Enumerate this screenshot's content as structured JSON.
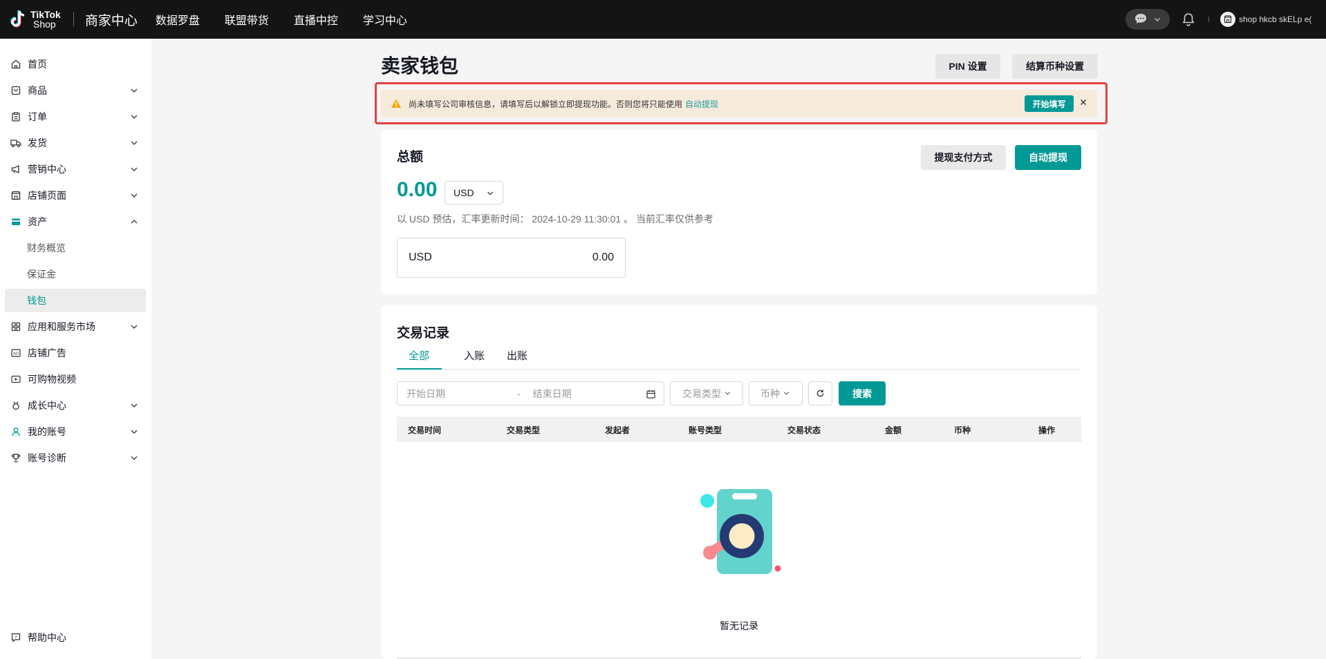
{
  "brand": {
    "logo_line1": "TikTok",
    "logo_line2": "Shop",
    "center_name": "商家中心"
  },
  "top_nav": [
    "数据罗盘",
    "联盟带货",
    "直播中控",
    "学习中心"
  ],
  "user": {
    "shop_name": "shop hkcb skELp e("
  },
  "sidebar": {
    "items": [
      {
        "label": "首页",
        "icon": "home-icon",
        "expandable": false
      },
      {
        "label": "商品",
        "icon": "product-icon",
        "expandable": true
      },
      {
        "label": "订单",
        "icon": "order-icon",
        "expandable": true
      },
      {
        "label": "发货",
        "icon": "truck-icon",
        "expandable": true
      },
      {
        "label": "营销中心",
        "icon": "megaphone-icon",
        "expandable": true
      },
      {
        "label": "店铺页面",
        "icon": "store-icon",
        "expandable": true
      },
      {
        "label": "资产",
        "icon": "wallet-icon",
        "expandable": true,
        "expanded": true
      },
      {
        "label": "财务概览",
        "sub": true
      },
      {
        "label": "保证金",
        "sub": true
      },
      {
        "label": "钱包",
        "sub": true,
        "active": true
      },
      {
        "label": "应用和服务市场",
        "icon": "apps-icon",
        "expandable": true
      },
      {
        "label": "店铺广告",
        "icon": "ad-icon",
        "expandable": false
      },
      {
        "label": "可购物视频",
        "icon": "video-icon",
        "expandable": false
      },
      {
        "label": "成长中心",
        "icon": "medal-icon",
        "expandable": true
      },
      {
        "label": "我的账号",
        "icon": "user-icon",
        "expandable": true
      },
      {
        "label": "账号诊断",
        "icon": "trophy-icon",
        "expandable": true
      }
    ],
    "help": "帮助中心"
  },
  "page": {
    "title": "卖家钱包",
    "pin_button": "PIN 设置",
    "currency_settings_button": "结算币种设置"
  },
  "alert": {
    "text": "尚未填写公司审核信息，请填写后以解锁立即提现功能。否则您将只能使用",
    "link": "自动提现",
    "action": "开始填写"
  },
  "total": {
    "title": "总额",
    "amount": "0.00",
    "currency": "USD",
    "rate_note": "以 USD 预估，汇率更新时间： 2024-10-29 11:30:01 。 当前汇率仅供参考",
    "withdraw_method_button": "提现支付方式",
    "auto_withdraw_button": "自动提现",
    "balance_currency": "USD",
    "balance_amount": "0.00"
  },
  "transactions": {
    "title": "交易记录",
    "tabs": [
      "全部",
      "入账",
      "出账"
    ],
    "active_tab": 0,
    "start_placeholder": "开始日期",
    "date_dash": "-",
    "end_placeholder": "结束日期",
    "type_filter": "交易类型",
    "currency_filter": "币种",
    "search_button": "搜索",
    "columns": [
      "交易时间",
      "交易类型",
      "发起者",
      "账号类型",
      "交易状态",
      "金额",
      "币种",
      "操作"
    ],
    "empty_text": "暂无记录"
  },
  "colors": {
    "accent": "#009995",
    "topbar": "#141414",
    "alert_bg": "#f6eadb",
    "alert_border": "#e34040"
  }
}
